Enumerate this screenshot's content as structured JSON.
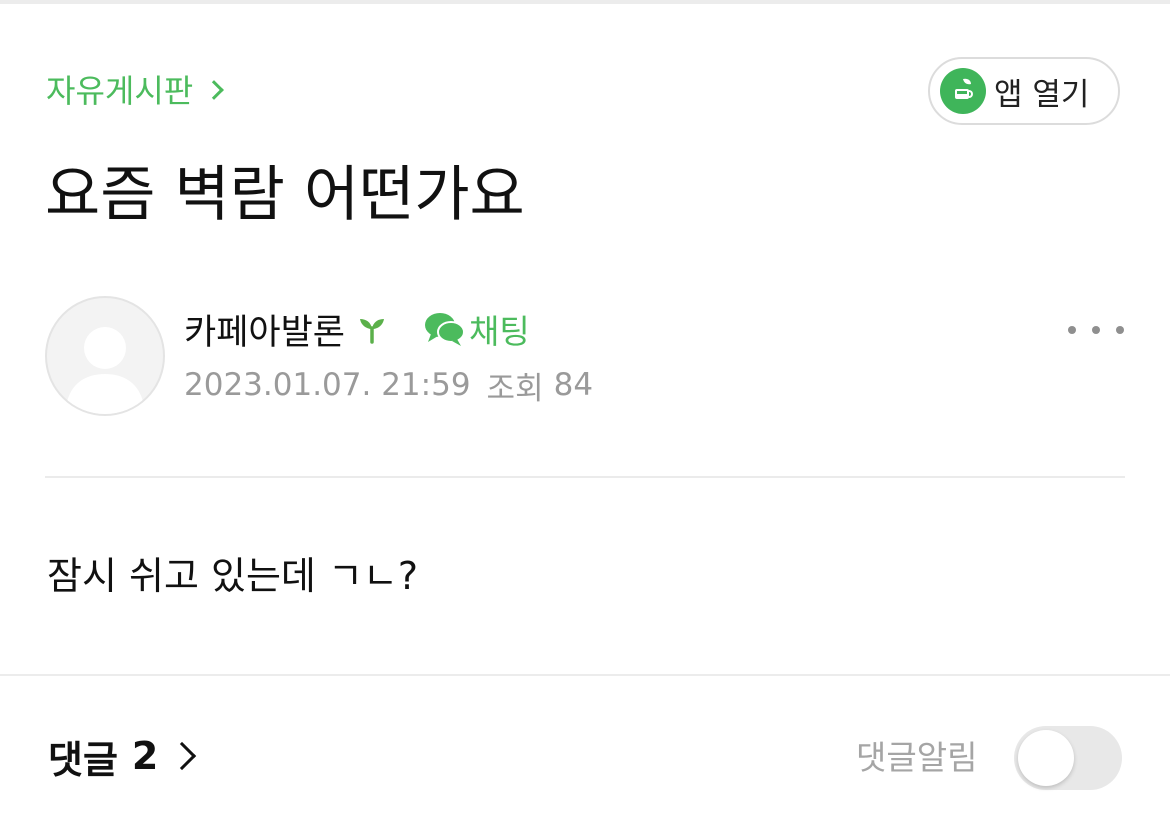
{
  "header": {
    "board_name": "자유게시판",
    "open_app_label": "앱 열기"
  },
  "post": {
    "title": "요즘 벽람 어떤가요",
    "author": {
      "name": "카페아발론",
      "level_icon": "sprout-icon",
      "chat_label": "채팅"
    },
    "date": "2023.01.07. 21:59",
    "views_label": "조회",
    "views_count": "84",
    "body": "잠시 쉬고 있는데 ㄱㄴ?"
  },
  "comments": {
    "label": "댓글",
    "count": "2",
    "notify_label": "댓글알림",
    "notify_enabled": false
  },
  "colors": {
    "accent": "#4cbb5d",
    "meta_text": "#9a9a9a",
    "divider": "#ebebeb"
  }
}
